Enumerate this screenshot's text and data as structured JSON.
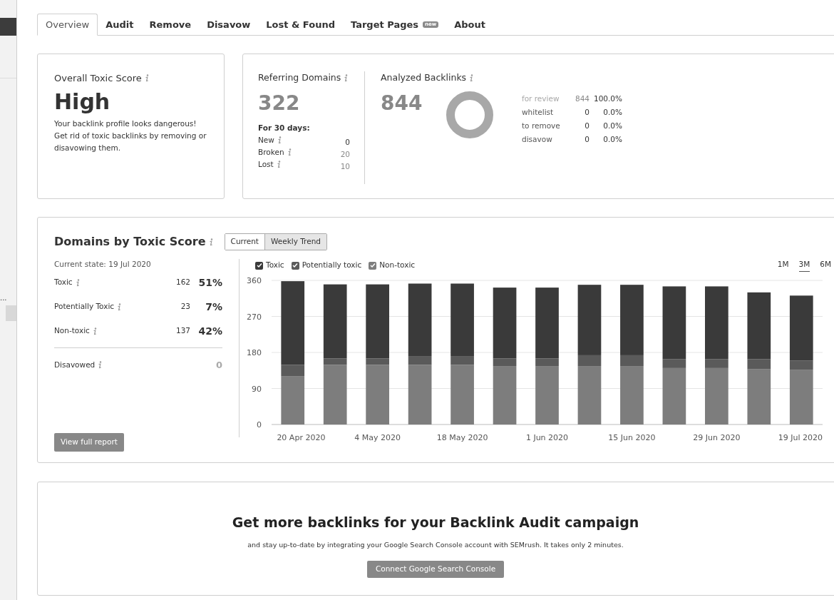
{
  "sidebar": {
    "truncated_label": "..."
  },
  "tabs": [
    {
      "label": "Overview",
      "selected": true
    },
    {
      "label": "Audit",
      "selected": false
    },
    {
      "label": "Remove",
      "selected": false
    },
    {
      "label": "Disavow",
      "selected": false
    },
    {
      "label": "Lost & Found",
      "selected": false
    },
    {
      "label": "Target Pages",
      "selected": false,
      "badge": "new"
    },
    {
      "label": "About",
      "selected": false
    }
  ],
  "toxic_score": {
    "title": "Overall Toxic Score",
    "value": "High",
    "description": "Your backlink profile looks dangerous! Get rid of toxic backlinks by removing or disavowing them."
  },
  "referring_domains": {
    "title": "Referring Domains",
    "value": "322",
    "period": "For 30 days:",
    "rows": [
      {
        "label": "New",
        "value": "0"
      },
      {
        "label": "Broken",
        "value": "20"
      },
      {
        "label": "Lost",
        "value": "10"
      }
    ]
  },
  "analyzed_backlinks": {
    "title": "Analyzed Backlinks",
    "value": "844",
    "rows": [
      {
        "label": "for review",
        "count": "844",
        "percent": "100.0%",
        "color": "#a8a8a8"
      },
      {
        "label": "whitelist",
        "count": "0",
        "percent": "0.0%",
        "color": "#555555"
      },
      {
        "label": "to remove",
        "count": "0",
        "percent": "0.0%",
        "color": "#555555"
      },
      {
        "label": "disavow",
        "count": "0",
        "percent": "0.0%",
        "color": "#555555"
      }
    ]
  },
  "domains_by_toxic_score": {
    "title": "Domains by Toxic Score",
    "views": [
      {
        "label": "Current",
        "selected": false
      },
      {
        "label": "Weekly Trend",
        "selected": true
      }
    ],
    "current_state": "Current state: 19 Jul 2020",
    "rows": [
      {
        "label": "Toxic",
        "count": "162",
        "percent": "51%"
      },
      {
        "label": "Potentially Toxic",
        "count": "23",
        "percent": "7%"
      },
      {
        "label": "Non-toxic",
        "count": "137",
        "percent": "42%"
      }
    ],
    "disavowed": {
      "label": "Disavowed",
      "value": "0"
    },
    "button": "View full report",
    "legend": [
      {
        "checked": true
      },
      {
        "checked": true
      },
      {
        "checked": true
      }
    ],
    "ranges": [
      {
        "label": "1M",
        "selected": false
      },
      {
        "label": "3M",
        "selected": true
      },
      {
        "label": "6M",
        "selected": false
      }
    ],
    "chart_data": {
      "type": "bar",
      "stacked": true,
      "grid": true,
      "ylim": [
        0,
        360
      ],
      "yticks": [
        0,
        90,
        180,
        270,
        360
      ],
      "categories": [
        "20 Apr 2020",
        null,
        "4 May 2020",
        null,
        "18 May 2020",
        null,
        "1 Jun 2020",
        null,
        "15 Jun 2020",
        null,
        "29 Jun 2020",
        null,
        "19 Jul 2020"
      ],
      "series": [
        {
          "name": "Non-toxic",
          "color": "#7d7d7d",
          "values": [
            121,
            149,
            149,
            149,
            149,
            146,
            146,
            146,
            146,
            141,
            141,
            138,
            137
          ]
        },
        {
          "name": "Potentially toxic",
          "color": "#5a5a5a",
          "values": [
            28,
            16,
            16,
            22,
            22,
            19,
            19,
            27,
            27,
            22,
            22,
            25,
            23
          ]
        },
        {
          "name": "Toxic",
          "color": "#3a3a3a",
          "values": [
            209,
            185,
            185,
            181,
            181,
            177,
            177,
            176,
            176,
            182,
            182,
            167,
            162
          ]
        }
      ]
    }
  },
  "promo": {
    "title": "Get more backlinks for your Backlink Audit campaign",
    "text": "and stay up-to-date by integrating your Google Search Console account with SEMrush. It takes only 2 minutes.",
    "button": "Connect Google Search Console"
  }
}
